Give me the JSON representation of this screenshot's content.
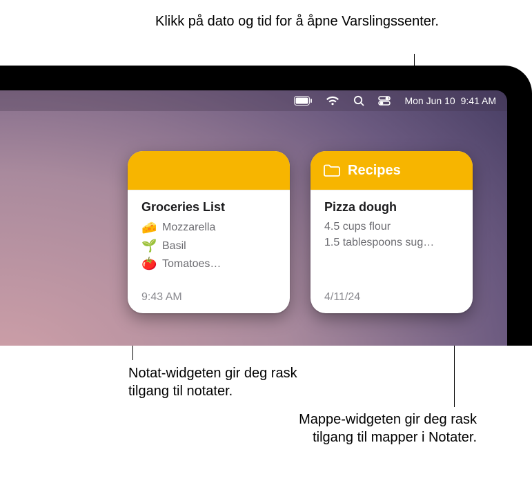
{
  "callouts": {
    "top": "Klikk på dato og tid for å åpne Varslingssenter.",
    "left": "Notat-widgeten gir deg rask tilgang til notater.",
    "right": "Mappe-widgeten gir deg rask tilgang til mapper i Notater."
  },
  "menubar": {
    "date": "Mon Jun 10",
    "time": "9:41 AM",
    "icons": [
      "battery-icon",
      "wifi-icon",
      "search-icon",
      "control-center-icon"
    ]
  },
  "widgets": {
    "note": {
      "title": "Groceries List",
      "items": [
        {
          "emoji": "🧀",
          "text": "Mozzarella"
        },
        {
          "emoji": "🌱",
          "text": "Basil"
        },
        {
          "emoji": "🍅",
          "text": "Tomatoes…"
        }
      ],
      "footer": "9:43 AM"
    },
    "folder": {
      "header": "Recipes",
      "title": "Pizza dough",
      "lines": [
        "4.5 cups flour",
        "1.5 tablespoons sug…"
      ],
      "footer": "4/11/24"
    }
  },
  "colors": {
    "notes_yellow": "#f7b500",
    "text_secondary": "#6b6b70",
    "text_tertiary": "#8a8a8f"
  }
}
